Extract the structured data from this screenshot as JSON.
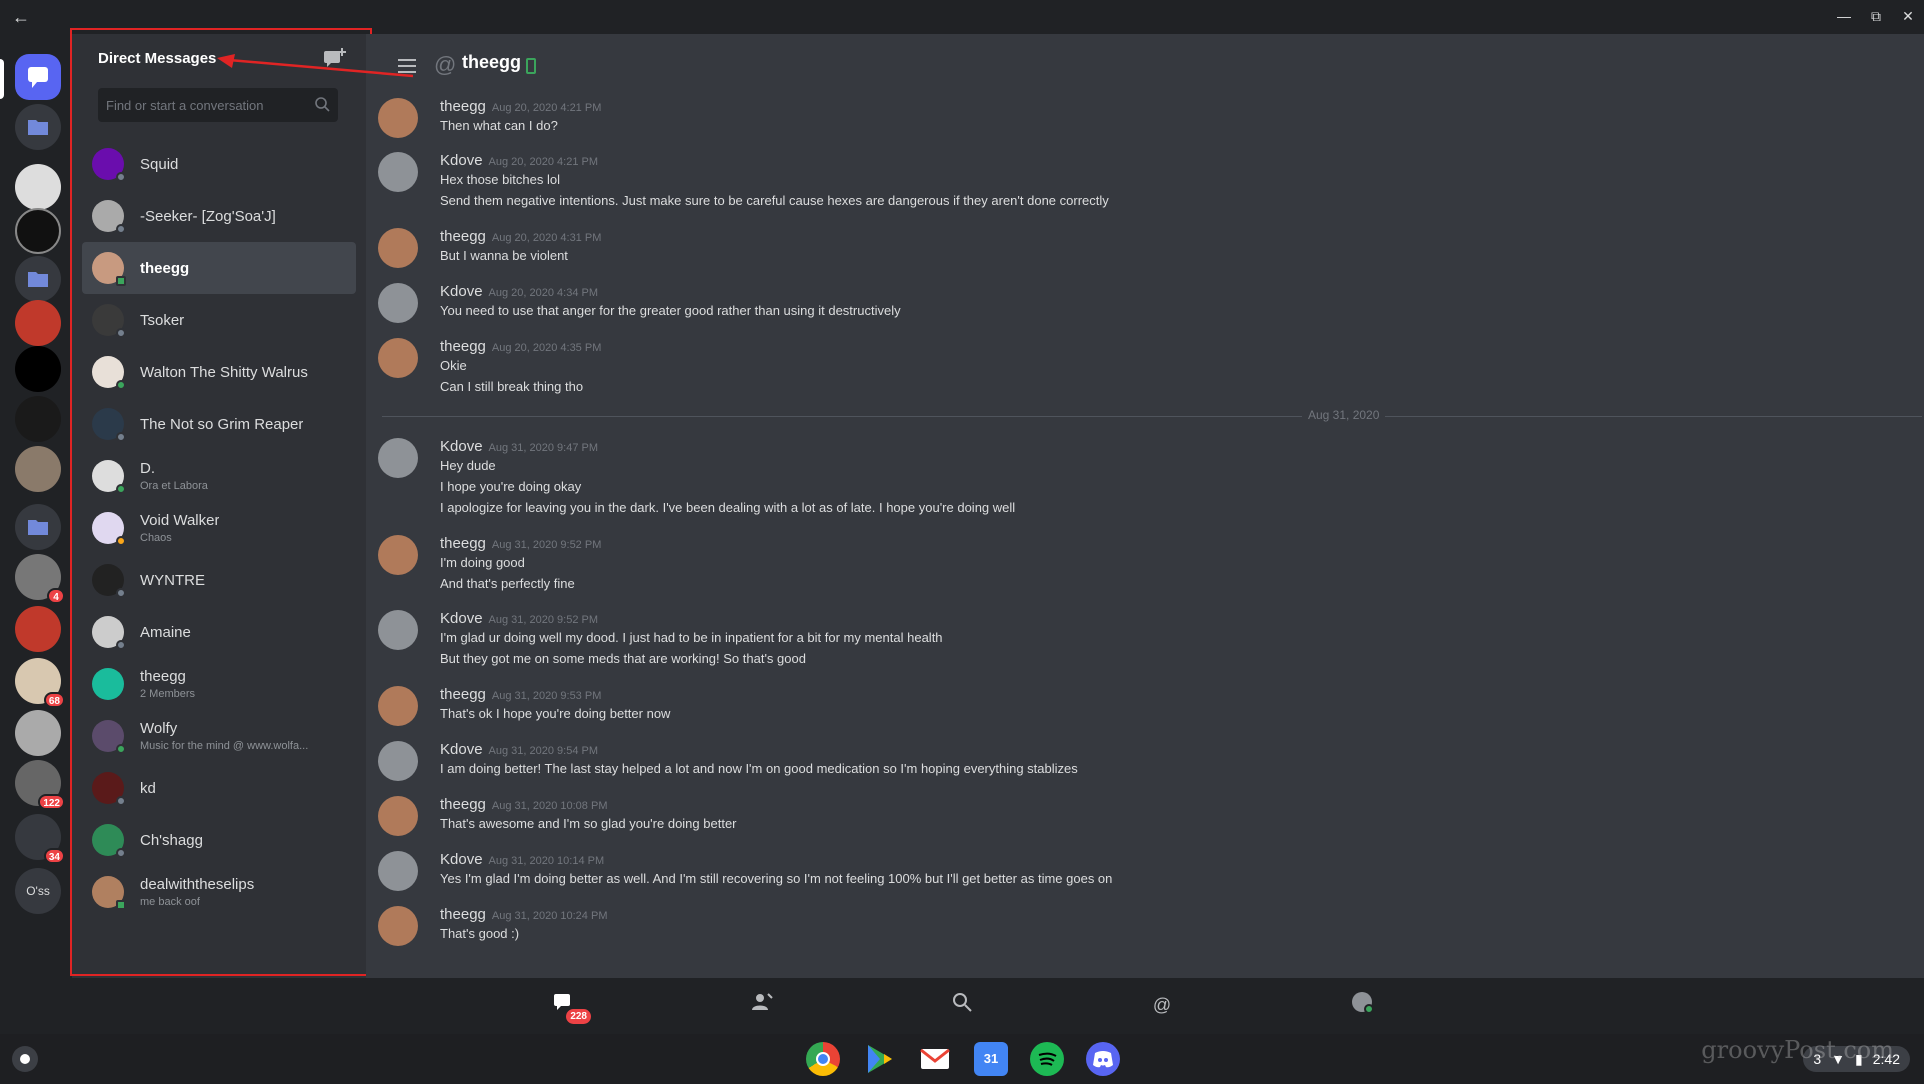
{
  "window": {
    "back_icon": "back-arrow-icon",
    "controls": [
      "minimize-icon",
      "restore-icon",
      "close-icon"
    ]
  },
  "rail": {
    "badges": [
      "4",
      "68",
      "122",
      "34"
    ],
    "last_label": "O'ss"
  },
  "dm": {
    "header": "Direct Messages",
    "search_placeholder": "Find or start a conversation",
    "items": [
      {
        "name": "Squid",
        "sub": ""
      },
      {
        "name": "-Seeker- [Zog'Soa'J]",
        "sub": ""
      },
      {
        "name": "theegg",
        "sub": ""
      },
      {
        "name": "Tsoker",
        "sub": ""
      },
      {
        "name": "Walton The Shitty Walrus",
        "sub": ""
      },
      {
        "name": "The Not so Grim Reaper",
        "sub": ""
      },
      {
        "name": "D.",
        "sub": "Ora et Labora"
      },
      {
        "name": "Void Walker",
        "sub": "Chaos"
      },
      {
        "name": "WYNTRE",
        "sub": ""
      },
      {
        "name": "Amaine",
        "sub": ""
      },
      {
        "name": "theegg",
        "sub": "2 Members"
      },
      {
        "name": "Wolfy",
        "sub": "Music for the mind @ www.wolfa..."
      },
      {
        "name": "kd",
        "sub": ""
      },
      {
        "name": "Ch'shagg",
        "sub": ""
      },
      {
        "name": "dealwiththeselips",
        "sub": "me back oof"
      }
    ]
  },
  "chat": {
    "title": "theegg",
    "divider": "Aug 31, 2020",
    "messages": [
      {
        "author": "theegg",
        "time": "Aug 20, 2020 4:21 PM",
        "lines": [
          "Then what can I do?"
        ]
      },
      {
        "author": "Kdove",
        "time": "Aug 20, 2020 4:21 PM",
        "lines": [
          "Hex those bitches lol",
          "Send them negative intentions. Just make sure to be careful cause hexes are dangerous if they aren't done correctly"
        ]
      },
      {
        "author": "theegg",
        "time": "Aug 20, 2020 4:31 PM",
        "lines": [
          "But I wanna be violent"
        ]
      },
      {
        "author": "Kdove",
        "time": "Aug 20, 2020 4:34 PM",
        "lines": [
          "You need to use that anger for the greater good rather than using it destructively"
        ]
      },
      {
        "author": "theegg",
        "time": "Aug 20, 2020 4:35 PM",
        "lines": [
          "Okie",
          "Can I still break thing tho"
        ]
      },
      {
        "author": "Kdove",
        "time": "Aug 31, 2020 9:47 PM",
        "lines": [
          "Hey dude",
          "I hope you're doing okay",
          "I apologize for leaving you in the dark. I've been dealing with a lot as of late. I hope you're doing well"
        ]
      },
      {
        "author": "theegg",
        "time": "Aug 31, 2020 9:52 PM",
        "lines": [
          "I'm doing good",
          "And that's perfectly fine"
        ]
      },
      {
        "author": "Kdove",
        "time": "Aug 31, 2020 9:52 PM",
        "lines": [
          "I'm glad ur doing well my dood. I just had to be in inpatient for a bit for my mental health",
          "But they got me on some meds that are working! So that's good"
        ]
      },
      {
        "author": "theegg",
        "time": "Aug 31, 2020 9:53 PM",
        "lines": [
          "That's ok I hope you're doing better now"
        ]
      },
      {
        "author": "Kdove",
        "time": "Aug 31, 2020 9:54 PM",
        "lines": [
          "I am doing better! The last stay helped a lot and now I'm on good medication so I'm hoping everything stablizes"
        ]
      },
      {
        "author": "theegg",
        "time": "Aug 31, 2020 10:08 PM",
        "lines": [
          "That's awesome and I'm so glad you're doing better"
        ]
      },
      {
        "author": "Kdove",
        "time": "Aug 31, 2020 10:14 PM",
        "lines": [
          "Yes I'm glad I'm doing better as well. And I'm still recovering so I'm not feeling 100% but I'll get better as time goes on"
        ]
      },
      {
        "author": "theegg",
        "time": "Aug 31, 2020 10:24 PM",
        "lines": [
          "That's good :)"
        ]
      }
    ]
  },
  "bottom_nav": {
    "badge": "228",
    "icons": [
      "home-icon",
      "friends-icon",
      "search-icon",
      "mentions-icon",
      "profile-icon"
    ]
  },
  "shelf": {
    "apps": [
      "chrome-icon",
      "play-store-icon",
      "gmail-icon",
      "calendar-icon",
      "spotify-icon",
      "discord-icon"
    ],
    "calendar_day": "31",
    "notif_count": "3",
    "time": "2:42"
  },
  "watermark": "groovyPost.com",
  "colors": {
    "accent": "#5865f2",
    "annotation": "#e02424",
    "online": "#3ba55c"
  }
}
